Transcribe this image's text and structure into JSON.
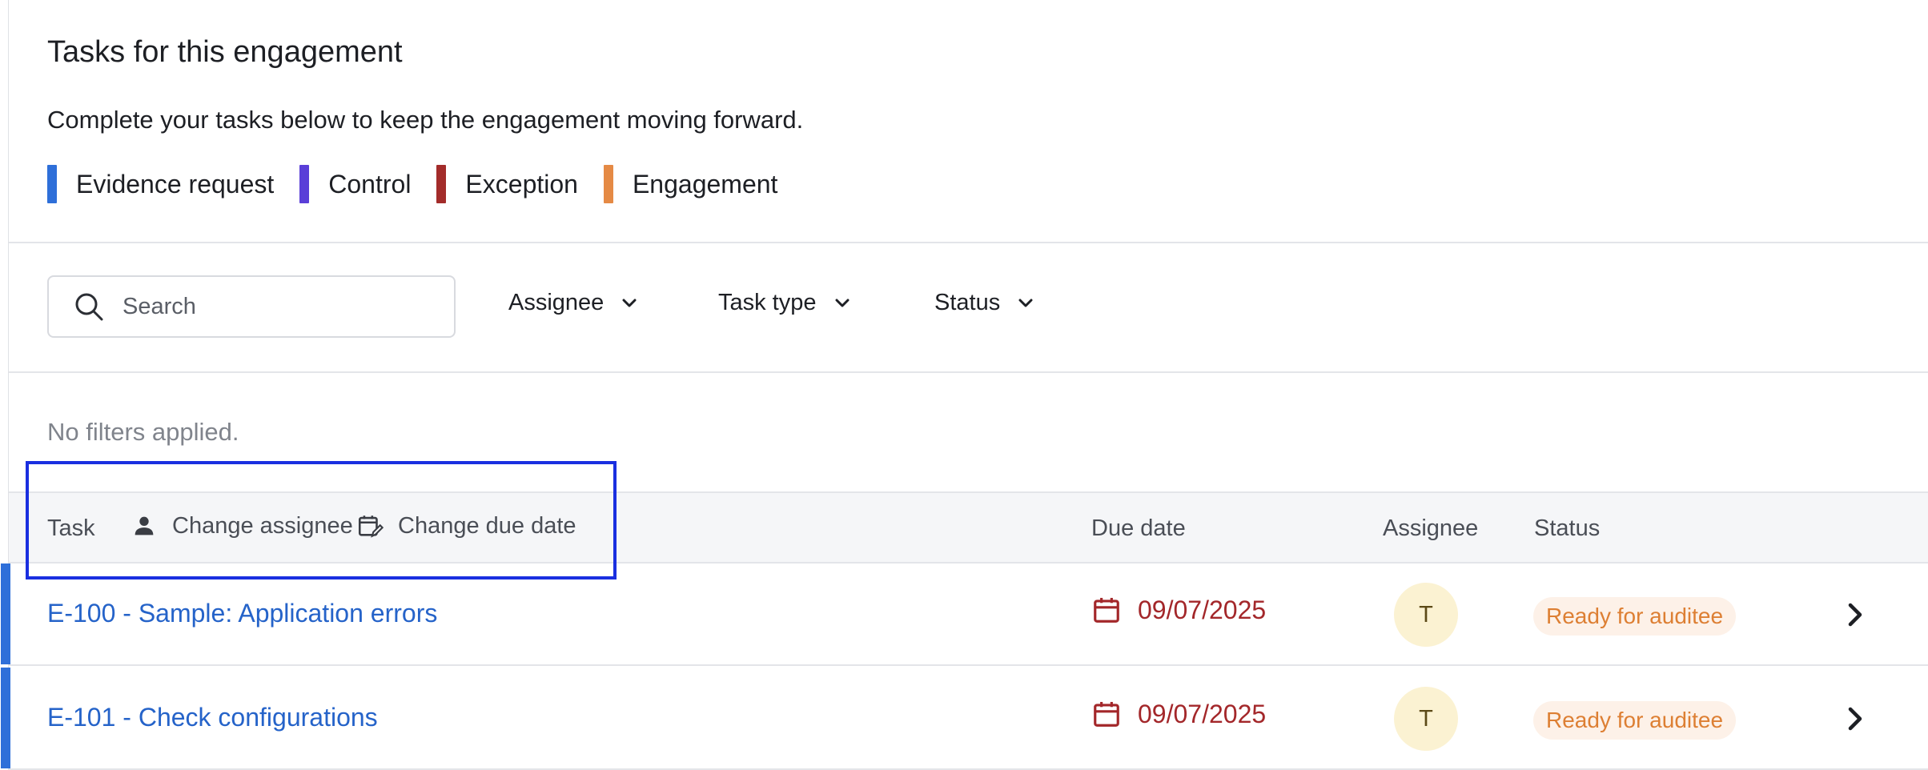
{
  "header": {
    "title": "Tasks for this engagement",
    "subtitle": "Complete your tasks below to keep the engagement moving forward."
  },
  "legend": [
    {
      "label": "Evidence request",
      "color": "#2e6fd9"
    },
    {
      "label": "Control",
      "color": "#5a3fd8"
    },
    {
      "label": "Exception",
      "color": "#a32c2a"
    },
    {
      "label": "Engagement",
      "color": "#e58a45"
    }
  ],
  "filters": {
    "search_placeholder": "Search",
    "assignee_label": "Assignee",
    "task_type_label": "Task type",
    "status_label": "Status",
    "no_filters_text": "No filters applied."
  },
  "table": {
    "columns": {
      "task": "Task",
      "change_assignee": "Change assignee",
      "change_due_date": "Change due date",
      "due_date": "Due date",
      "assignee": "Assignee",
      "status": "Status"
    },
    "rows": [
      {
        "task": "E-100 - Sample: Application errors",
        "due_date": "09/07/2025",
        "assignee_initial": "T",
        "status": "Ready for auditee"
      },
      {
        "task": "E-101 - Check configurations",
        "due_date": "09/07/2025",
        "assignee_initial": "T",
        "status": "Ready for auditee"
      }
    ]
  }
}
